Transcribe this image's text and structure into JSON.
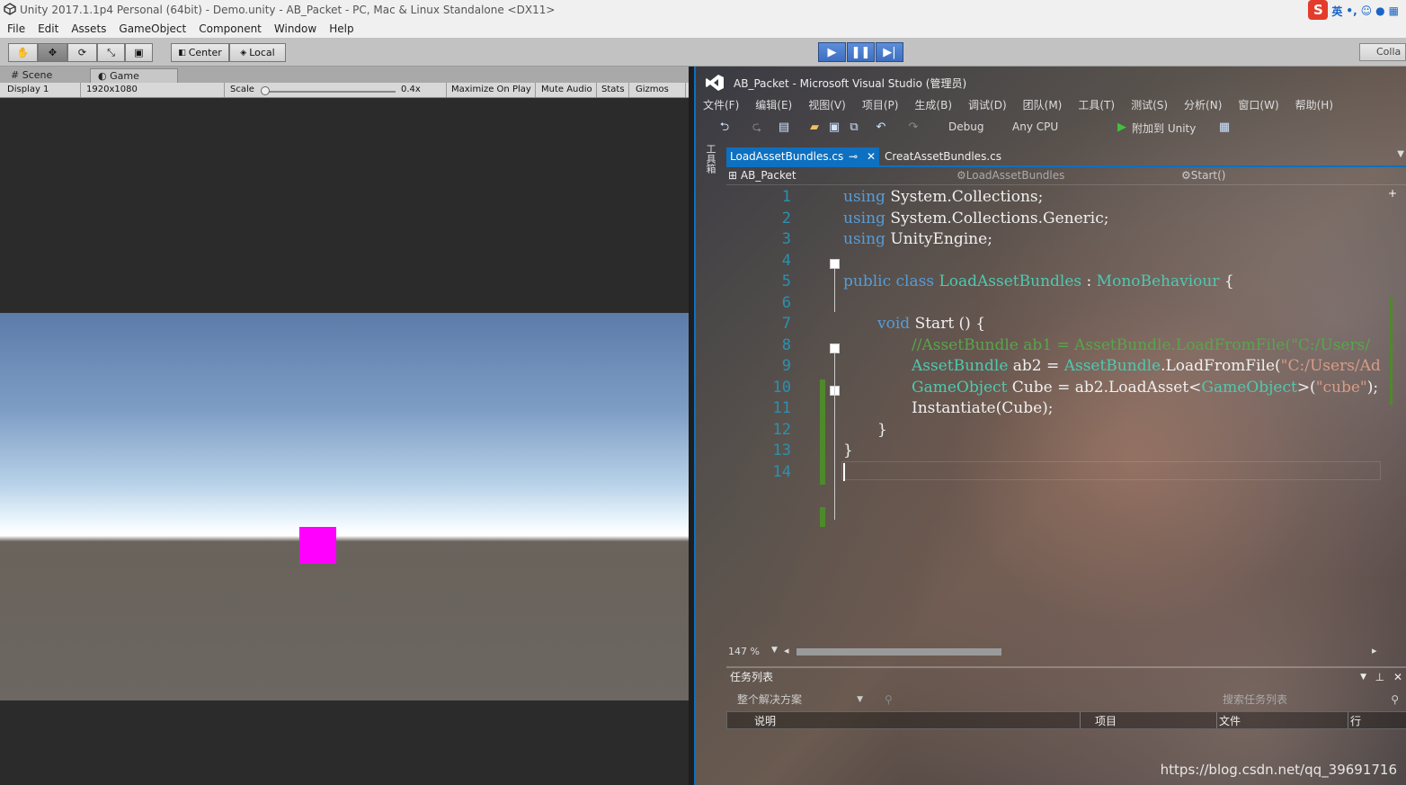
{
  "unity": {
    "window_title": "Unity 2017.1.1p4 Personal (64bit) - Demo.unity - AB_Packet - PC, Mac & Linux Standalone <DX11>",
    "menu": [
      "File",
      "Edit",
      "Assets",
      "GameObject",
      "Component",
      "Window",
      "Help"
    ],
    "toolbar": {
      "center_label": "Center",
      "local_label": "Local",
      "collab_label": "Colla"
    },
    "tabs": {
      "scene": "Scene",
      "game": "Game"
    },
    "game_bar": {
      "display": "Display 1",
      "resolution": "1920x1080",
      "scale_label": "Scale",
      "scale_value": "0.4x",
      "maximize": "Maximize On Play",
      "mute": "Mute Audio",
      "stats": "Stats",
      "gizmos": "Gizmos"
    },
    "cube_color": "#ff00ff"
  },
  "ime": {
    "logo": "S",
    "lang": "英"
  },
  "vs": {
    "title": "AB_Packet - Microsoft Visual Studio (管理员)",
    "menu": [
      "文件(F)",
      "编辑(E)",
      "视图(V)",
      "项目(P)",
      "生成(B)",
      "调试(D)",
      "团队(M)",
      "工具(T)",
      "测试(S)",
      "分析(N)",
      "窗口(W)",
      "帮助(H)"
    ],
    "config": "Debug",
    "platform": "Any CPU",
    "attach": "附加到 Unity",
    "side_label": "工具箱",
    "tabs": [
      {
        "label": "LoadAssetBundles.cs"
      },
      {
        "label": "CreatAssetBundles.cs"
      }
    ],
    "nav": {
      "project": "AB_Packet",
      "class": "LoadAssetBundles",
      "member": "Start()"
    },
    "line_numbers": [
      "1",
      "2",
      "3",
      "4",
      "5",
      "6",
      "7",
      "8",
      "9",
      "10",
      "11",
      "12",
      "13",
      "14"
    ],
    "code": {
      "l1_kw": "using",
      "l1_rest": " System.Collections;",
      "l2_kw": "using",
      "l2_rest": " System.Collections.Generic;",
      "l3_kw": "using",
      "l3_rest": " UnityEngine;",
      "l5_kw": "public class",
      "l5_cls": "LoadAssetBundles",
      "l5_colon": " : ",
      "l5_base": "MonoBehaviour",
      "l5_brace": " {",
      "l7_kw": "void",
      "l7_rest": " Start () {",
      "l8": "//AssetBundle ab1 = AssetBundle.LoadFromFile(\"C:/Users/",
      "l9_ty": "AssetBundle",
      "l9_a": " ab2 = ",
      "l9_ty2": "AssetBundle",
      "l9_b": ".LoadFromFile(",
      "l9_str": "\"C:/Users/Ad",
      "l10_ty": "GameObject",
      "l10_a": " Cube = ab2.LoadAsset<",
      "l10_ty2": "GameObject",
      "l10_b": ">(",
      "l10_str": "\"cube\"",
      "l10_c": ");",
      "l11": "Instantiate(Cube);",
      "l12": "}",
      "l13": "}"
    },
    "zoom": "147 %",
    "tasklist": {
      "title": "任务列表",
      "scope": "整个解决方案",
      "search_placeholder": "搜索任务列表",
      "cols": [
        "说明",
        "项目",
        "文件",
        "行"
      ]
    },
    "watermark": "https://blog.csdn.net/qq_39691716"
  }
}
